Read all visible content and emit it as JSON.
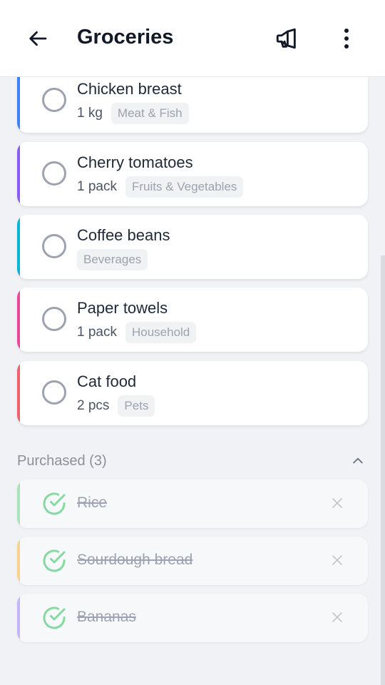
{
  "header": {
    "title": "Groceries",
    "back_icon": "arrow-left-icon",
    "announce_icon": "megaphone-icon",
    "more_icon": "more-vertical-icon"
  },
  "items": [
    {
      "name": "Chicken breast",
      "quantity": "1 kg",
      "category": "Meat & Fish",
      "color": "#3b82f6"
    },
    {
      "name": "Cherry tomatoes",
      "quantity": "1 pack",
      "category": "Fruits & Vegetables",
      "color": "#8b5cf6"
    },
    {
      "name": "Coffee beans",
      "quantity": "",
      "category": "Beverages",
      "color": "#06b6d4"
    },
    {
      "name": "Paper towels",
      "quantity": "1 pack",
      "category": "Household",
      "color": "#ec4899"
    },
    {
      "name": "Cat food",
      "quantity": "2 pcs",
      "category": "Pets",
      "color": "#f0616d"
    }
  ],
  "purchased": {
    "label": "Purchased (3)",
    "collapse_icon": "chevron-up-icon",
    "items": [
      {
        "name": "Rice",
        "color": "#a7e3bd"
      },
      {
        "name": "Sourdough bread",
        "color": "#f5d48e"
      },
      {
        "name": "Bananas",
        "color": "#c4b5fd"
      }
    ]
  },
  "colors": {
    "check_done": "#86d9a3",
    "circle_border": "#9ca3af"
  }
}
